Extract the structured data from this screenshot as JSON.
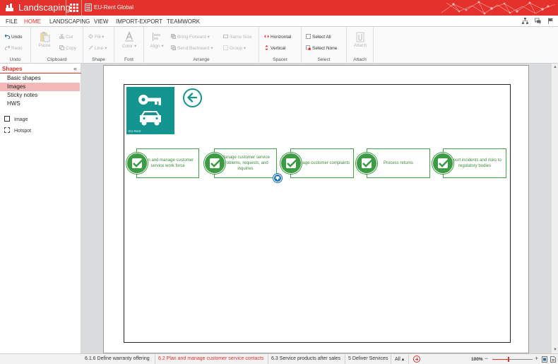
{
  "app": {
    "name": "Landscaping",
    "repository": "EU-Rent Global"
  },
  "menu": {
    "tabs": [
      "FILE",
      "HOME",
      "LANDSCAPING",
      "VIEW",
      "IMPORT-EXPORT",
      "TEAMWORK"
    ],
    "active": "HOME"
  },
  "ribbon": {
    "undo": {
      "undo": "Undo",
      "redo": "Redo",
      "title": "Undo"
    },
    "clipboard": {
      "paste": "Paste",
      "cut": "Cut",
      "copy": "Copy",
      "title": "Clipboard"
    },
    "shape": {
      "fill": "Fill",
      "line": "Line",
      "title": "Shape"
    },
    "font": {
      "color": "Color",
      "title": "Font"
    },
    "arrange": {
      "align": "Align",
      "bring_forward": "Bring Forward",
      "send_backward": "Send Backward",
      "same_size": "Same Size",
      "group": "Group",
      "title": "Arrange"
    },
    "spacer": {
      "horizontal": "Horizontal",
      "vertical": "Vertical",
      "title": "Spacer"
    },
    "select": {
      "select_all": "Select All",
      "select_none": "Select None",
      "title": "Select"
    },
    "attach": {
      "attach": "Attach",
      "title": "Attach"
    }
  },
  "shapes_panel": {
    "title": "Shapes",
    "collapse": "«",
    "categories": [
      "Basic shapes",
      "Images",
      "Sticky notes",
      "HWS"
    ],
    "selected_category": "Images",
    "items": [
      "Image",
      "Hotspot"
    ]
  },
  "diagram": {
    "tile_label": "EU-Rent",
    "processes": [
      "Plan and manage customer service work force",
      "Manage customer service problems, requests, and inquiries",
      "Manage customer complaints",
      "Process returns",
      "Report incidents and risks to regulatory bodies"
    ]
  },
  "bottom_tabs": {
    "tabs": [
      "6.1.6 Define warranty offering",
      "6.2 Plan and manage customer service contacts",
      "6.3 Service products after sales",
      "5 Deliver Services",
      "All"
    ],
    "active": "6.2 Plan and manage customer service contacts",
    "all_caret": "▴"
  },
  "zoom": {
    "label": "100%",
    "minus": "−",
    "plus": "+",
    "fraction": 0.4
  },
  "colors": {
    "brand_red": "#e4312b",
    "teal": "#13958f",
    "green": "#3d9b44",
    "blue_badge": "#1b6fb3"
  }
}
